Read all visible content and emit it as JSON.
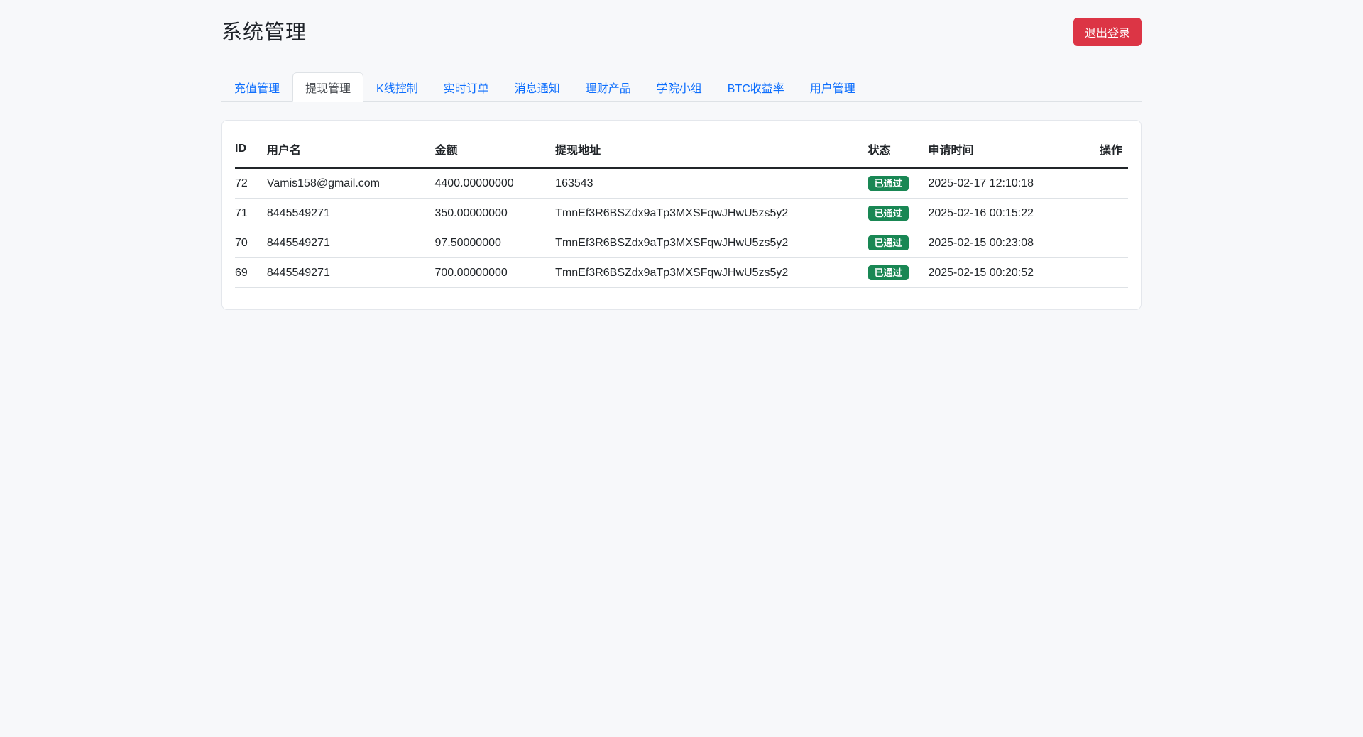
{
  "page": {
    "title": "系统管理",
    "background_color": "#f7f8fa"
  },
  "header": {
    "logout_label": "退出登录",
    "logout_color": "#dc3545"
  },
  "tabs": [
    {
      "label": "充值管理",
      "active": false
    },
    {
      "label": "提现管理",
      "active": true
    },
    {
      "label": "K线控制",
      "active": false
    },
    {
      "label": "实时订单",
      "active": false
    },
    {
      "label": "消息通知",
      "active": false
    },
    {
      "label": "理财产品",
      "active": false
    },
    {
      "label": "学院小组",
      "active": false
    },
    {
      "label": "BTC收益率",
      "active": false
    },
    {
      "label": "用户管理",
      "active": false
    }
  ],
  "colors": {
    "link_blue": "#0d6efd",
    "badge_green": "#198754",
    "danger_red": "#dc3545"
  },
  "table": {
    "columns": [
      "ID",
      "用户名",
      "金额",
      "提现地址",
      "状态",
      "申请时间",
      "操作"
    ],
    "rows": [
      {
        "id": "72",
        "username": "Vamis158@gmail.com",
        "amount": "4400.00000000",
        "address": "163543",
        "status": "已通过",
        "time": "2025-02-17 12:10:18",
        "action": ""
      },
      {
        "id": "71",
        "username": "8445549271",
        "amount": "350.00000000",
        "address": "TmnEf3R6BSZdx9aTp3MXSFqwJHwU5zs5y2",
        "status": "已通过",
        "time": "2025-02-16 00:15:22",
        "action": ""
      },
      {
        "id": "70",
        "username": "8445549271",
        "amount": "97.50000000",
        "address": "TmnEf3R6BSZdx9aTp3MXSFqwJHwU5zs5y2",
        "status": "已通过",
        "time": "2025-02-15 00:23:08",
        "action": ""
      },
      {
        "id": "69",
        "username": "8445549271",
        "amount": "700.00000000",
        "address": "TmnEf3R6BSZdx9aTp3MXSFqwJHwU5zs5y2",
        "status": "已通过",
        "time": "2025-02-15 00:20:52",
        "action": ""
      }
    ]
  }
}
